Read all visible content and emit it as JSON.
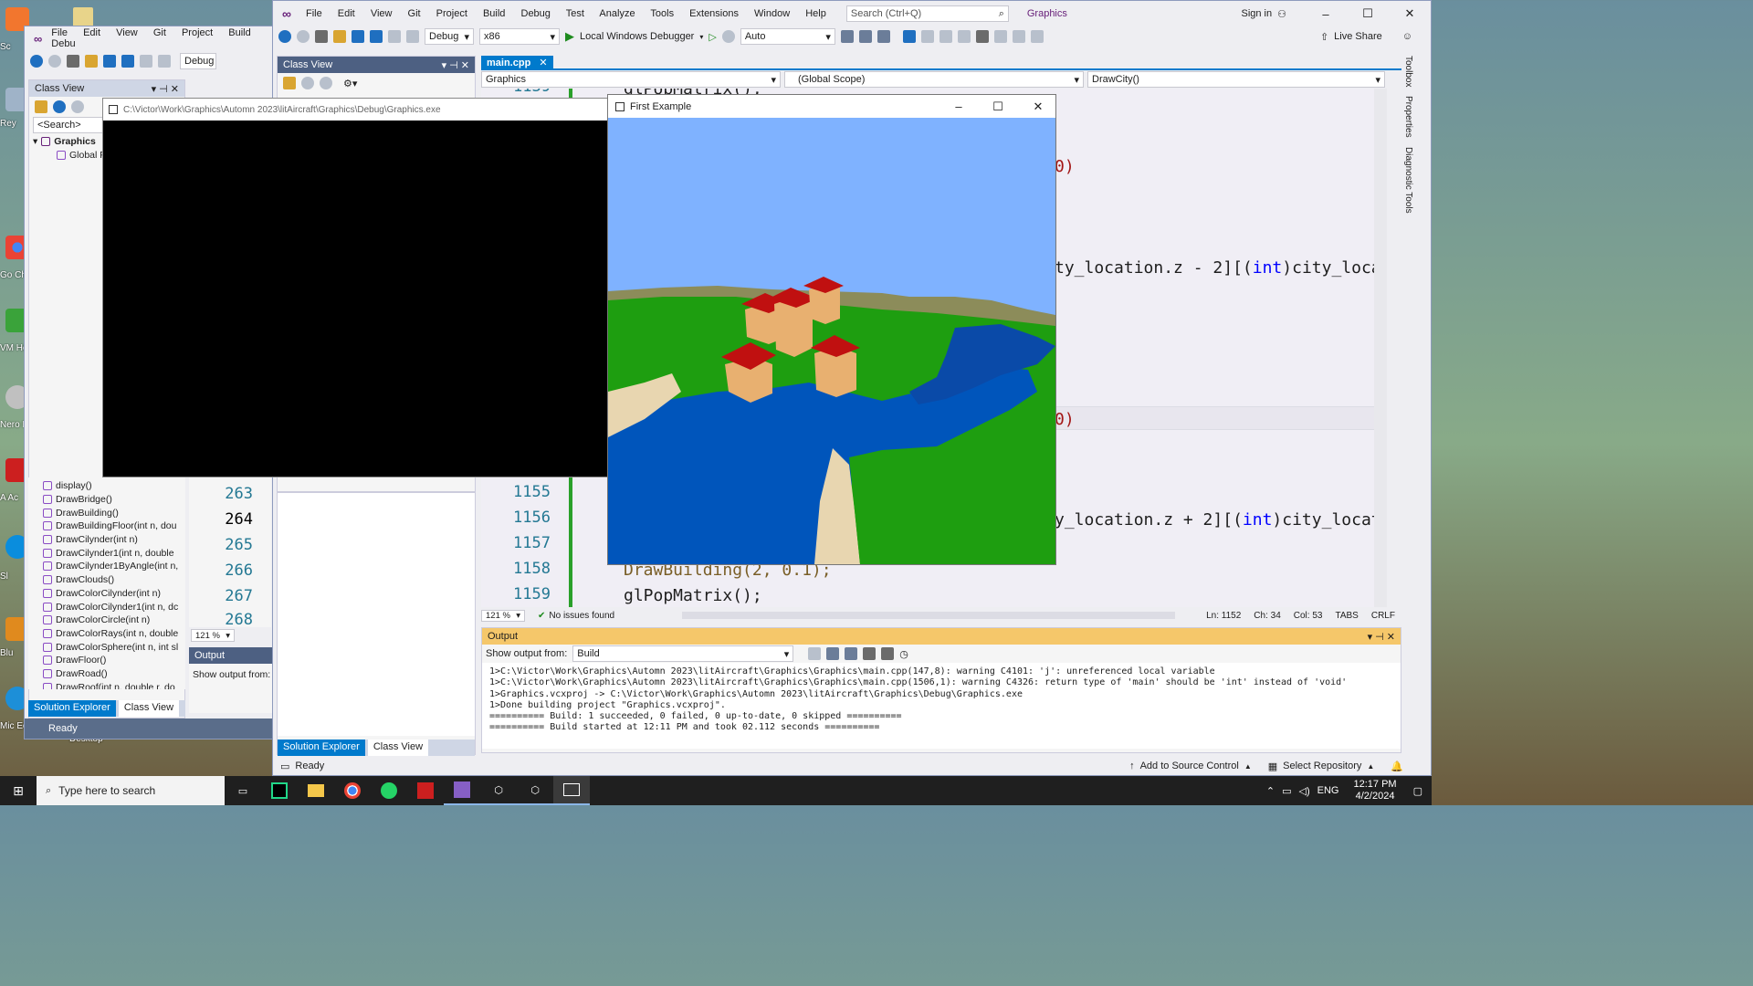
{
  "desktop": {
    "icons": [
      {
        "label": "Sc"
      },
      {
        "label": "Rey"
      },
      {
        "label": "Go Ch"
      },
      {
        "label": "VM Ho"
      },
      {
        "label": "Nero R"
      },
      {
        "label": "A Ac"
      },
      {
        "label": "Sl"
      },
      {
        "label": "Blu"
      },
      {
        "label": "Mic Edge"
      }
    ],
    "desktop_label": "Desktop"
  },
  "vs_main": {
    "menu": [
      "File",
      "Edit",
      "View",
      "Git",
      "Project",
      "Build",
      "Debug",
      "Test",
      "Analyze",
      "Tools",
      "Extensions",
      "Window",
      "Help"
    ],
    "search_placeholder": "Search (Ctrl+Q)",
    "solution_name": "Graphics",
    "sign_in": "Sign in",
    "config": "Debug",
    "platform": "x86",
    "debugger": "Local Windows Debugger",
    "auto": "Auto",
    "live_share": "Live Share",
    "class_view_title": "Class View",
    "doc_tab": "main.cpp",
    "nav_project": "Graphics",
    "nav_scope": "(Global Scope)",
    "nav_member": "DrawCity()",
    "code_lines": [
      {
        "num": "1139",
        "text": "glPopMatrix();"
      },
      {
        "num": "1155",
        "text": ""
      },
      {
        "num": "1156",
        "text": ""
      },
      {
        "num": "1157",
        "text": ""
      },
      {
        "num": "1158",
        "text": "DrawBuilding(2, 0.1);"
      },
      {
        "num": "1159",
        "text": "glPopMatrix();"
      }
    ],
    "code_frag_1": "0)",
    "code_frag_2a": "ty_location.z - 2][(",
    "code_frag_2b": "int",
    "code_frag_2c": ")city_location.x], cit",
    "code_frag_3": "0)",
    "code_frag_4a": "y_location.z + 2][(",
    "code_frag_4b": "int",
    "code_frag_4c": ")city_location.x], cit",
    "zoom": "121 %",
    "issues": "No issues found",
    "ln": "Ln: 1152",
    "ch": "Ch: 34",
    "col": "Col: 53",
    "tabs": "TABS",
    "crlf": "CRLF",
    "output_title": "Output",
    "show_output_from": "Show output from:",
    "output_source": "Build",
    "output_lines": [
      "1>C:\\Victor\\Work\\Graphics\\Automn 2023\\litAircraft\\Graphics\\Graphics\\main.cpp(147,8): warning C4101: 'j': unreferenced local variable",
      "1>C:\\Victor\\Work\\Graphics\\Automn 2023\\litAircraft\\Graphics\\Graphics\\main.cpp(1506,1): warning C4326: return type of 'main' should be 'int' instead of 'void'",
      "1>Graphics.vcxproj -> C:\\Victor\\Work\\Graphics\\Automn 2023\\litAircraft\\Graphics\\Debug\\Graphics.exe",
      "1>Done building project \"Graphics.vcxproj\".",
      "========== Build: 1 succeeded, 0 failed, 0 up-to-date, 0 skipped ==========",
      "========== Build started at 12:11 PM and took 02.112 seconds =========="
    ],
    "solution_explorer_tab": "Solution Explorer",
    "class_view_tab": "Class View",
    "status_ready": "Ready",
    "add_source_control": "Add to Source Control",
    "select_repository": "Select Repository",
    "side_tabs": [
      "Toolbox",
      "Properties",
      "Diagnostic Tools"
    ]
  },
  "vs_back": {
    "menu": [
      "File",
      "Edit",
      "View",
      "Git",
      "Project",
      "Build",
      "Debu"
    ],
    "config": "Debug",
    "class_view_title": "Class View",
    "search_placeholder": "<Search>",
    "tree_root": "Graphics",
    "tree_child": "Global F",
    "members": [
      "display()",
      "DrawBridge()",
      "DrawBuilding()",
      "DrawBuildingFloor(int n, dou",
      "DrawCilynder(int n)",
      "DrawCilynder1(int n, double",
      "DrawCilynder1ByAngle(int n,",
      "DrawClouds()",
      "DrawColorCilynder(int n)",
      "DrawColorCilynder1(int n, dc",
      "DrawColorCircle(int n)",
      "DrawColorRays(int n, double",
      "DrawColorSphere(int n, int sl",
      "DrawFloor()",
      "DrawRoad()",
      "DrawRoof(int n, double r, do"
    ],
    "line_numbers": [
      "263",
      "264",
      "265",
      "266",
      "267",
      "268"
    ],
    "zoom": "121 %",
    "output_title": "Output",
    "show_output_from": "Show output from:",
    "solution_explorer_tab": "Solution Explorer",
    "class_view_tab": "Class View",
    "status_ready": "Ready"
  },
  "console": {
    "title": "C:\\Victor\\Work\\Graphics\\Automn 2023\\litAircraft\\Graphics\\Debug\\Graphics.exe"
  },
  "gl_window": {
    "title": "First Example"
  },
  "taskbar": {
    "search_placeholder": "Type here to search",
    "lang": "ENG",
    "time": "12:17 PM",
    "date": "4/2/2024"
  },
  "colors": {
    "vs_accent": "#007acc",
    "sky": "#7fb2ff",
    "grass": "#1e9e10",
    "water": "#0055bb",
    "roof": "#c01010",
    "building": "#e8b070"
  }
}
